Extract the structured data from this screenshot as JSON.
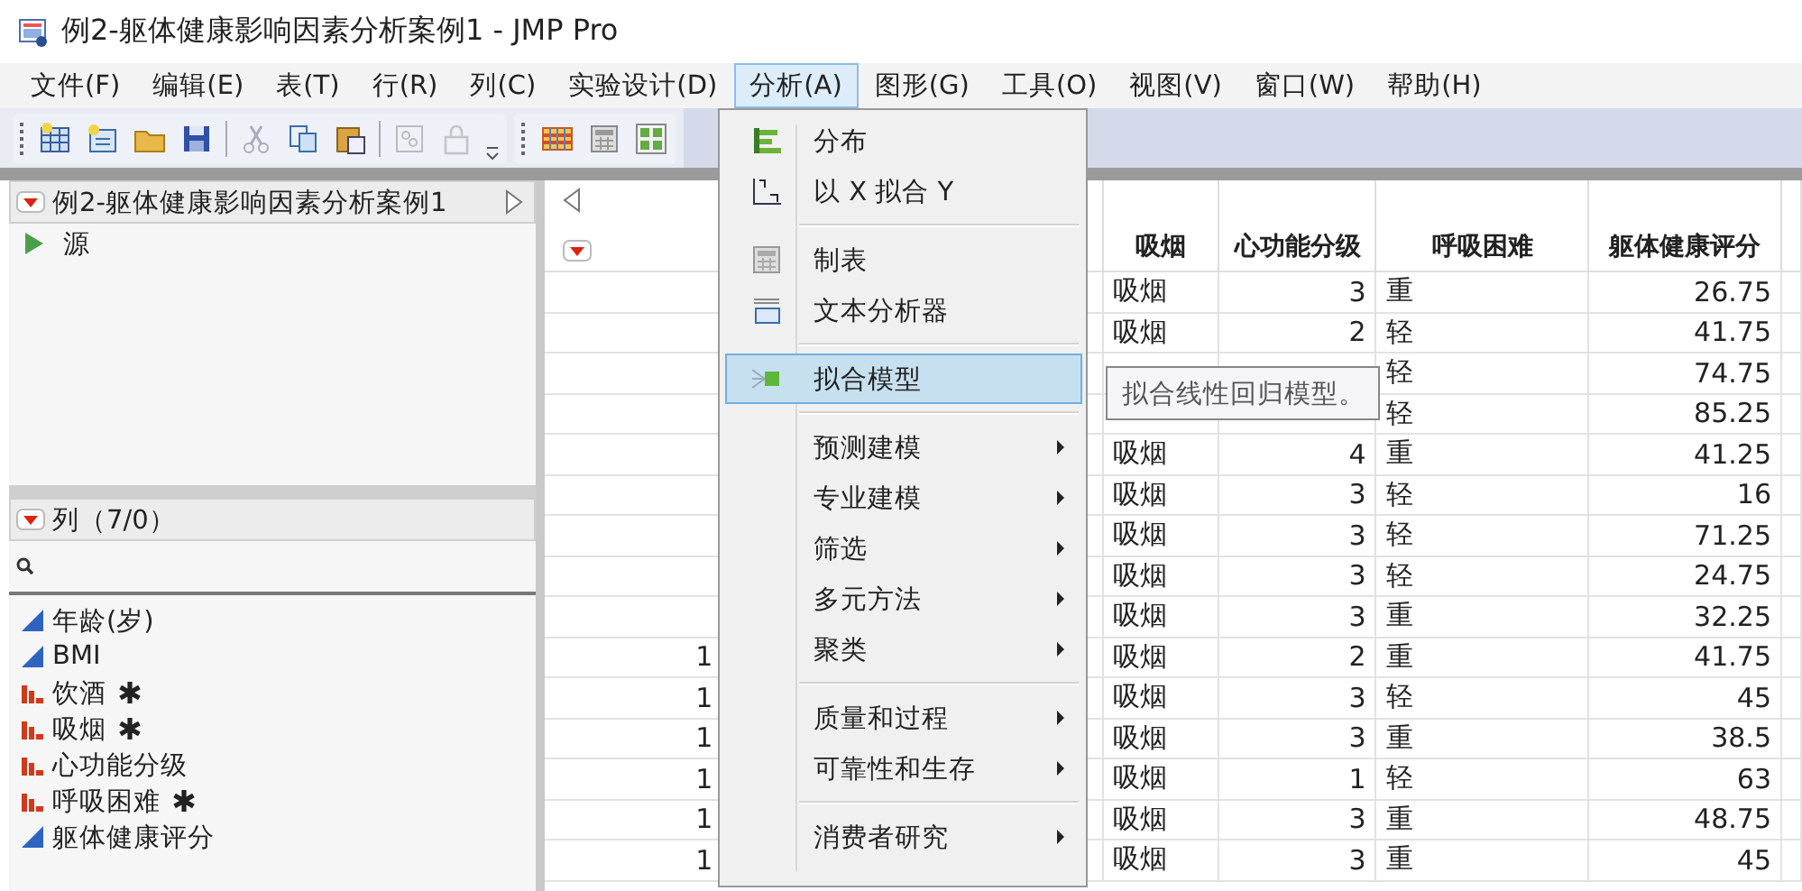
{
  "window": {
    "title": "例2-躯体健康影响因素分析案例1 - JMP Pro"
  },
  "menubar": [
    {
      "label": "文件(F)",
      "selected": false
    },
    {
      "label": "编辑(E)",
      "selected": false
    },
    {
      "label": "表(T)",
      "selected": false
    },
    {
      "label": "行(R)",
      "selected": false
    },
    {
      "label": "列(C)",
      "selected": false
    },
    {
      "label": "实验设计(D)",
      "selected": false
    },
    {
      "label": "分析(A)",
      "selected": true
    },
    {
      "label": "图形(G)",
      "selected": false
    },
    {
      "label": "工具(O)",
      "selected": false
    },
    {
      "label": "视图(V)",
      "selected": false
    },
    {
      "label": "窗口(W)",
      "selected": false
    },
    {
      "label": "帮助(H)",
      "selected": false
    }
  ],
  "table_panel": {
    "title": "例2-躯体健康影响因素分析案例1",
    "items": [
      "源"
    ]
  },
  "columns_panel": {
    "title": "列（7/0）",
    "columns": [
      {
        "name": "年龄(岁)",
        "kind": "continuous",
        "flagged": false
      },
      {
        "name": "BMI",
        "kind": "continuous",
        "flagged": false
      },
      {
        "name": "饮酒",
        "kind": "nominal",
        "flagged": true
      },
      {
        "name": "吸烟",
        "kind": "nominal",
        "flagged": true
      },
      {
        "name": "心功能分级",
        "kind": "nominal",
        "flagged": false
      },
      {
        "name": "呼吸困难",
        "kind": "nominal",
        "flagged": true
      },
      {
        "name": "躯体健康评分",
        "kind": "continuous",
        "flagged": false
      }
    ]
  },
  "grid": {
    "columns": [
      "吸烟",
      "心功能分级",
      "呼吸困难",
      "躯体健康评分"
    ],
    "rows": [
      {
        "row_label": null,
        "cells": [
          "吸烟",
          "3",
          "重",
          "26.75"
        ]
      },
      {
        "row_label": null,
        "cells": [
          "吸烟",
          "2",
          "轻",
          "41.75"
        ]
      },
      {
        "row_label": null,
        "cells": [
          null,
          null,
          "轻",
          "74.75"
        ]
      },
      {
        "row_label": null,
        "cells": [
          null,
          null,
          "轻",
          "85.25"
        ]
      },
      {
        "row_label": null,
        "cells": [
          "吸烟",
          "4",
          "重",
          "41.25"
        ]
      },
      {
        "row_label": null,
        "cells": [
          "吸烟",
          "3",
          "轻",
          "16"
        ]
      },
      {
        "row_label": null,
        "cells": [
          "吸烟",
          "3",
          "轻",
          "71.25"
        ]
      },
      {
        "row_label": null,
        "cells": [
          "吸烟",
          "3",
          "轻",
          "24.75"
        ]
      },
      {
        "row_label": null,
        "cells": [
          "吸烟",
          "3",
          "重",
          "32.25"
        ]
      },
      {
        "row_label": "1",
        "cells": [
          "吸烟",
          "2",
          "重",
          "41.75"
        ]
      },
      {
        "row_label": "1",
        "cells": [
          "吸烟",
          "3",
          "轻",
          "45"
        ]
      },
      {
        "row_label": "1",
        "cells": [
          "吸烟",
          "3",
          "重",
          "38.5"
        ]
      },
      {
        "row_label": "1",
        "cells": [
          "吸烟",
          "1",
          "轻",
          "63"
        ]
      },
      {
        "row_label": "1",
        "cells": [
          "吸烟",
          "3",
          "重",
          "48.75"
        ]
      },
      {
        "row_label": "1",
        "cells": [
          "吸烟",
          "3",
          "重",
          "45"
        ]
      }
    ]
  },
  "dropdown_menu": {
    "groups": [
      [
        {
          "label": "分布",
          "submenu": false,
          "selected": false
        },
        {
          "label": "以 X 拟合 Y",
          "submenu": false,
          "selected": false
        }
      ],
      [
        {
          "label": "制表",
          "submenu": false,
          "selected": false
        },
        {
          "label": "文本分析器",
          "submenu": false,
          "selected": false
        }
      ],
      [
        {
          "label": "拟合模型",
          "submenu": false,
          "selected": true
        }
      ],
      [
        {
          "label": "预测建模",
          "submenu": true,
          "selected": false
        },
        {
          "label": "专业建模",
          "submenu": true,
          "selected": false
        },
        {
          "label": "筛选",
          "submenu": true,
          "selected": false
        },
        {
          "label": "多元方法",
          "submenu": true,
          "selected": false
        },
        {
          "label": "聚类",
          "submenu": true,
          "selected": false
        }
      ],
      [
        {
          "label": "质量和过程",
          "submenu": true,
          "selected": false
        },
        {
          "label": "可靠性和生存",
          "submenu": true,
          "selected": false
        }
      ],
      [
        {
          "label": "消费者研究",
          "submenu": true,
          "selected": false
        }
      ]
    ]
  },
  "tooltip": {
    "text": "拟合线性回归模型。"
  }
}
